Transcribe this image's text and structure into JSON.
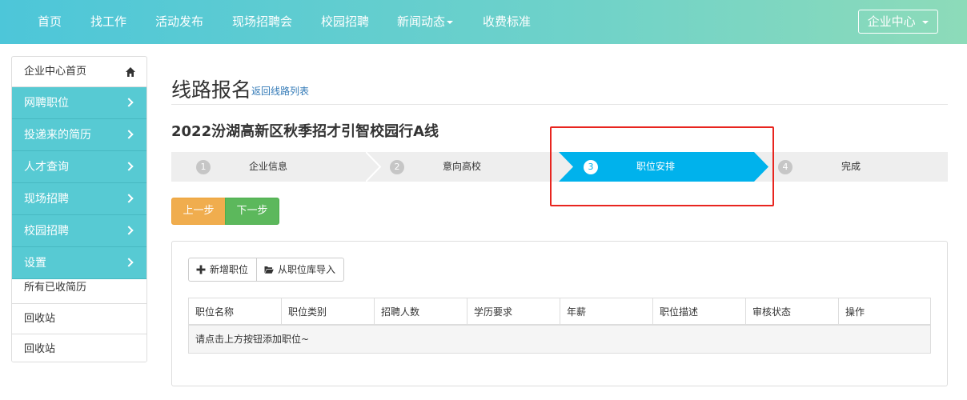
{
  "nav": {
    "items": [
      {
        "label": "首页"
      },
      {
        "label": "找工作"
      },
      {
        "label": "活动发布"
      },
      {
        "label": "现场招聘会"
      },
      {
        "label": "校园招聘"
      },
      {
        "label": "新闻动态"
      },
      {
        "label": "收费标准"
      }
    ],
    "enterprise_center": "企业中心"
  },
  "sidebar": {
    "home": "企业中心首页",
    "menu": [
      {
        "label": "网聘职位"
      },
      {
        "label": "投递来的简历"
      },
      {
        "label": "人才查询"
      },
      {
        "label": "现场招聘"
      },
      {
        "label": "校园招聘"
      },
      {
        "label": "设置"
      }
    ],
    "extra": [
      {
        "label": "所有已收简历"
      },
      {
        "label": "回收站"
      },
      {
        "label": "回收站"
      }
    ]
  },
  "page": {
    "title": "线路报名",
    "back_link": "返回线路列表",
    "route_name": "2022汾湖高新区秋季招才引智校园行A线"
  },
  "steps": [
    {
      "num": "1",
      "label": "企业信息"
    },
    {
      "num": "2",
      "label": "意向高校"
    },
    {
      "num": "3",
      "label": "职位安排",
      "active": true
    },
    {
      "num": "4",
      "label": "完成"
    }
  ],
  "buttons": {
    "prev": "上一步",
    "next": "下一步",
    "add_position": "新增职位",
    "import_position": "从职位库导入"
  },
  "table": {
    "columns": [
      "职位名称",
      "职位类别",
      "招聘人数",
      "学历要求",
      "年薪",
      "职位描述",
      "审核状态",
      "操作"
    ],
    "empty_message": "请点击上方按钮添加职位~"
  },
  "colors": {
    "nav_gradient_start": "#4dc6d9",
    "nav_gradient_end": "#8ddbb9",
    "sidebar_active": "#57cad3",
    "step_active": "#00b2ec",
    "btn_prev": "#f0ad4e",
    "btn_next": "#5cb85c",
    "highlight_box": "#e8251f"
  }
}
